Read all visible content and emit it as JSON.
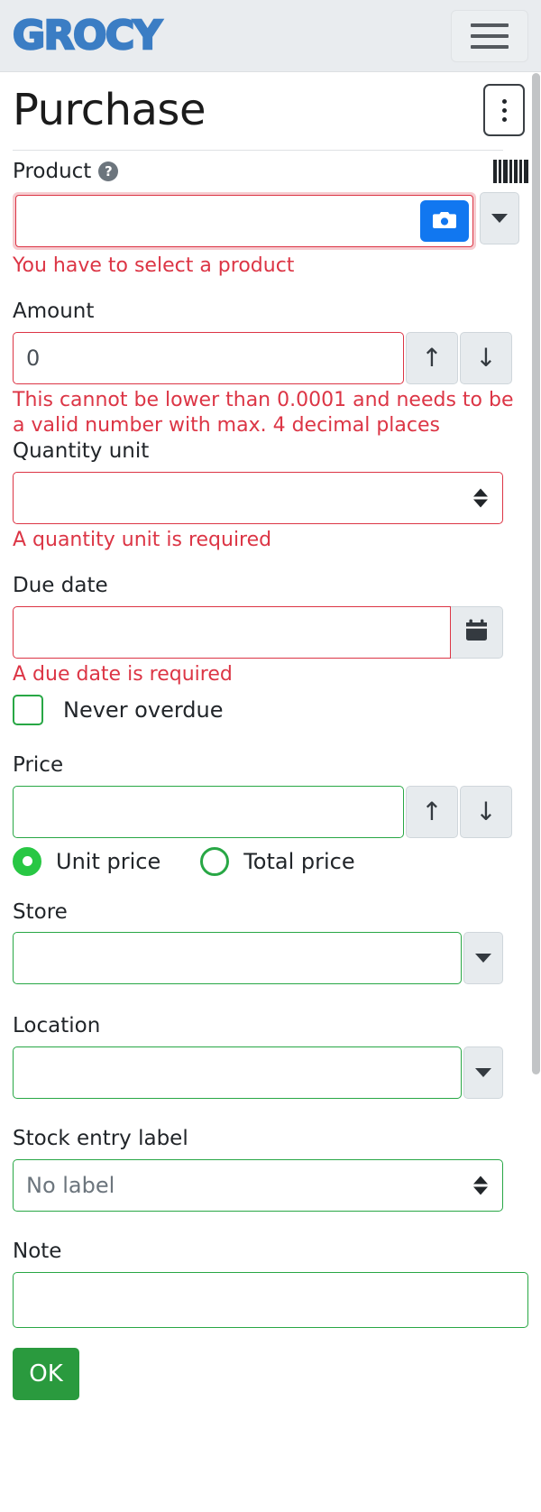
{
  "navbar": {
    "brand": "GROCY",
    "menu_icon": "hamburger-icon"
  },
  "header": {
    "title": "Purchase",
    "options_icon": "kebab-menu-icon"
  },
  "colors": {
    "brand_blue": "#3b7dc4",
    "valid_green": "#28a745",
    "invalid_red": "#dc3545",
    "camera_blue": "#1177f0",
    "ok_button_green": "#2a9a3e",
    "navbar_bg": "#e9ecef"
  },
  "form": {
    "product": {
      "label": "Product",
      "help_icon": "question-mark-icon",
      "barcode_icon": "barcode-icon",
      "value": "",
      "camera_icon": "camera-icon",
      "dropdown_icon": "caret-down-icon",
      "error": "You have to select a product",
      "state": "invalid"
    },
    "amount": {
      "label": "Amount",
      "value": "0",
      "increment_icon": "arrow-up-icon",
      "decrement_icon": "arrow-down-icon",
      "error": "This cannot be lower than 0.0001 and needs to be a valid number with max. 4 decimal places",
      "state": "invalid"
    },
    "quantity_unit": {
      "label": "Quantity unit",
      "value": "",
      "select_icon": "select-arrows-icon",
      "error": "A quantity unit is required",
      "state": "invalid"
    },
    "due_date": {
      "label": "Due date",
      "value": "",
      "calendar_icon": "calendar-icon",
      "error": "A due date is required",
      "state": "invalid"
    },
    "never_overdue": {
      "label": "Never overdue",
      "checked": false
    },
    "price": {
      "label": "Price",
      "value": "",
      "increment_icon": "arrow-up-icon",
      "decrement_icon": "arrow-down-icon",
      "state": "valid"
    },
    "price_type": {
      "options": [
        {
          "label": "Unit price",
          "selected": true
        },
        {
          "label": "Total price",
          "selected": false
        }
      ]
    },
    "store": {
      "label": "Store",
      "value": "",
      "dropdown_icon": "caret-down-icon",
      "state": "valid"
    },
    "location": {
      "label": "Location",
      "value": "",
      "dropdown_icon": "caret-down-icon",
      "state": "valid"
    },
    "stock_entry_label": {
      "label": "Stock entry label",
      "value": "No label",
      "select_icon": "select-arrows-icon",
      "state": "valid"
    },
    "note": {
      "label": "Note",
      "value": "",
      "state": "valid"
    },
    "submit": {
      "label": "OK"
    }
  }
}
